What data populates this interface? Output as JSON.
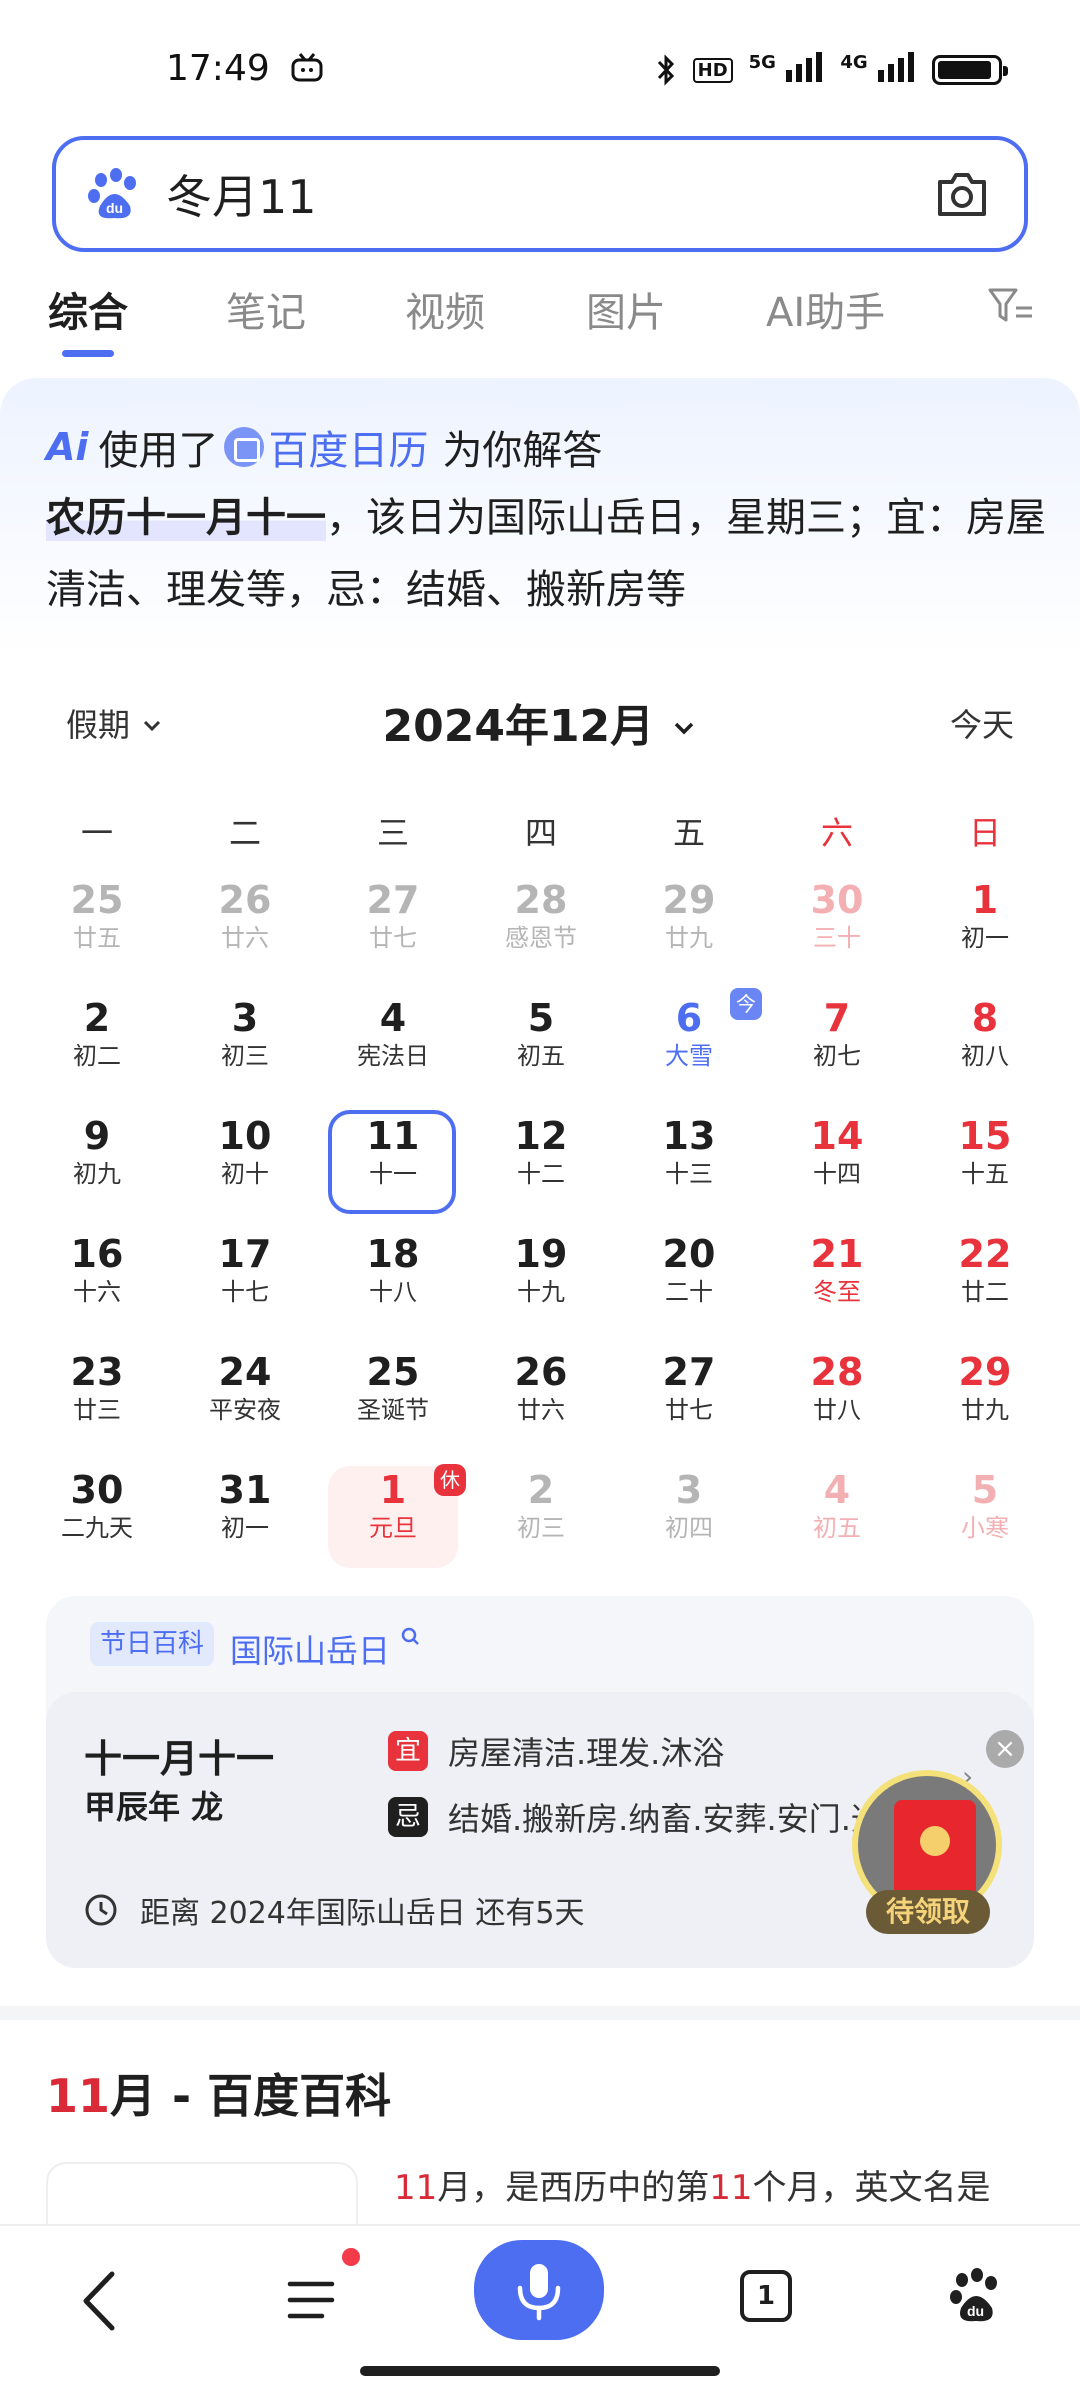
{
  "status_bar": {
    "time": "17:49",
    "icons": [
      "tv-emoji-icon",
      "bluetooth-icon",
      "hd-icon",
      "5g-signal-icon",
      "4g-signal-icon",
      "battery-icon"
    ],
    "hd_label": "HD",
    "net1": "5G",
    "net2": "4G"
  },
  "search": {
    "query": "冬月11",
    "logo_icon": "baidu-paw-icon",
    "camera_icon": "camera-icon"
  },
  "tabs": [
    {
      "label": "综合",
      "active": true
    },
    {
      "label": "笔记"
    },
    {
      "label": "视频"
    },
    {
      "label": "图片"
    },
    {
      "label": "AI助手"
    }
  ],
  "filter_icon": "filter-icon",
  "ai_answer": {
    "badge": "Ai",
    "prefix": "使用了",
    "source": "百度日历",
    "suffix": "为你解答",
    "highlight": "农历十一月十一",
    "answer_rest": "，该日为国际山岳日，星期三；宜：房屋清洁、理发等，忌：结婚、搬新房等"
  },
  "calendar": {
    "holiday_dropdown": "假期",
    "month_title": "2024年12月",
    "today_button": "今天",
    "weekdays": [
      "一",
      "二",
      "三",
      "四",
      "五",
      "六",
      "日"
    ],
    "today_tag": "今",
    "rest_tag": "休",
    "weeks": [
      [
        {
          "d": "25",
          "l": "廿五",
          "outside": true
        },
        {
          "d": "26",
          "l": "廿六",
          "outside": true
        },
        {
          "d": "27",
          "l": "廿七",
          "outside": true
        },
        {
          "d": "28",
          "l": "感恩节",
          "outside": true
        },
        {
          "d": "29",
          "l": "廿九",
          "outside": true
        },
        {
          "d": "30",
          "l": "三十",
          "outside": true
        },
        {
          "d": "1",
          "l": "初一"
        }
      ],
      [
        {
          "d": "2",
          "l": "初二"
        },
        {
          "d": "3",
          "l": "初三"
        },
        {
          "d": "4",
          "l": "宪法日"
        },
        {
          "d": "5",
          "l": "初五"
        },
        {
          "d": "6",
          "l": "大雪",
          "today": true
        },
        {
          "d": "7",
          "l": "初七"
        },
        {
          "d": "8",
          "l": "初八"
        }
      ],
      [
        {
          "d": "9",
          "l": "初九"
        },
        {
          "d": "10",
          "l": "初十"
        },
        {
          "d": "11",
          "l": "十一",
          "selected": true
        },
        {
          "d": "12",
          "l": "十二"
        },
        {
          "d": "13",
          "l": "十三"
        },
        {
          "d": "14",
          "l": "十四"
        },
        {
          "d": "15",
          "l": "十五"
        }
      ],
      [
        {
          "d": "16",
          "l": "十六"
        },
        {
          "d": "17",
          "l": "十七"
        },
        {
          "d": "18",
          "l": "十八"
        },
        {
          "d": "19",
          "l": "十九"
        },
        {
          "d": "20",
          "l": "二十"
        },
        {
          "d": "21",
          "l": "冬至",
          "red_lunar": true
        },
        {
          "d": "22",
          "l": "廿二"
        }
      ],
      [
        {
          "d": "23",
          "l": "廿三"
        },
        {
          "d": "24",
          "l": "平安夜"
        },
        {
          "d": "25",
          "l": "圣诞节"
        },
        {
          "d": "26",
          "l": "廿六"
        },
        {
          "d": "27",
          "l": "廿七"
        },
        {
          "d": "28",
          "l": "廿八"
        },
        {
          "d": "29",
          "l": "廿九"
        }
      ],
      [
        {
          "d": "30",
          "l": "二九天"
        },
        {
          "d": "31",
          "l": "初一"
        },
        {
          "d": "1",
          "l": "元旦",
          "holiday": true
        },
        {
          "d": "2",
          "l": "初三",
          "outside": true
        },
        {
          "d": "3",
          "l": "初四",
          "outside": true
        },
        {
          "d": "4",
          "l": "初五",
          "outside": true
        },
        {
          "d": "5",
          "l": "小寒",
          "outside": true
        }
      ]
    ]
  },
  "festival": {
    "tag": "节日百科",
    "name": "国际山岳日",
    "search_icon": "search-icon",
    "lunar_date": "十一月十一",
    "ganzhi": "甲辰年 龙",
    "yi_badge": "宜",
    "yi_text": "房屋清洁.理发.沐浴",
    "ji_badge": "忌",
    "ji_text": "结婚.搬新房.纳畜.安葬.安门.造",
    "countdown": "距离 2024年国际山岳日 还有5天",
    "packet_label": "待领取",
    "close_icon": "close-icon"
  },
  "baike": {
    "title_num": "11",
    "title_rest": "月 - 百度百科",
    "text_num": "11",
    "text_a": "月，是西历中的第",
    "text_num2": "11",
    "text_b": "个月，英文名是"
  },
  "bottom_nav": {
    "tab_count": "1",
    "items": [
      "back-icon",
      "menu-icon",
      "voice-mic-icon",
      "tabs-icon",
      "baidu-home-icon"
    ]
  },
  "colors": {
    "accent": "#4e6ef2",
    "red": "#e8333c"
  }
}
